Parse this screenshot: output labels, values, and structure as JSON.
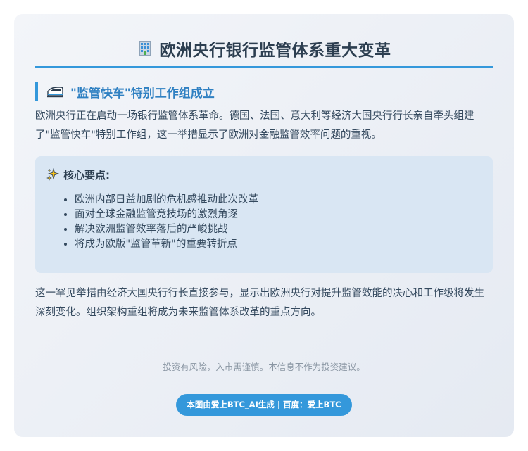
{
  "header": {
    "icon": "office-building-icon",
    "title": "欧洲央行银行监管体系重大变革"
  },
  "section": {
    "icon": "bullet-train-icon",
    "title": "\"监管快车\"特别工作组成立"
  },
  "intro": "欧洲央行正在启动一场银行监管体系革命。德国、法国、意大利等经济大国央行行长亲自牵头组建了\"监管快车\"特别工作组，这一举措显示了欧洲对金融监管效率问题的重视。",
  "key_points": {
    "icon": "sparkles-icon",
    "title": "核心要点:",
    "items": [
      "欧洲内部日益加剧的危机感推动此次改革",
      "面对全球金融监管竞技场的激烈角逐",
      "解决欧洲监管效率落后的严峻挑战",
      "将成为欧版\"监管革新\"的重要转折点"
    ]
  },
  "conclusion": "这一罕见举措由经济大国央行行长直接参与，显示出欧洲央行对提升监管效能的决心和工作级将发生深刻变化。组织架构重组将成为未来监管体系改革的重点方向。",
  "footer": {
    "disclaimer": "投资有风险，入市需谨慎。本信息不作为投资建议。",
    "badge": "本图由爱上BTC_AI生成 | 百度：爱上BTC"
  },
  "colors": {
    "accent": "#3498db",
    "title": "#2c3e50",
    "section_title": "#2f80c2",
    "body_text": "#34495e",
    "points_bg": "#d9e6f3",
    "muted": "#8a96a3"
  }
}
